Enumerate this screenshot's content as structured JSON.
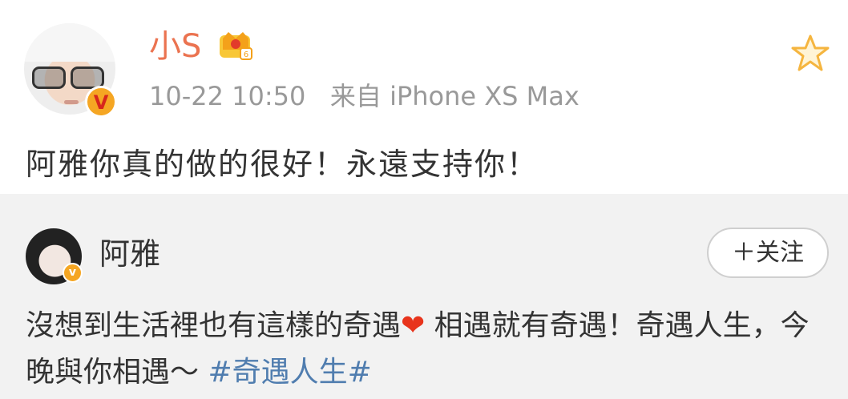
{
  "original_post": {
    "username": "小S",
    "meta_time": "10-22 10:50",
    "meta_source": "来自 iPhone XS Max",
    "text": "阿雅你真的做的很好！永遠支持你！"
  },
  "reposted": {
    "username": "阿雅",
    "follow_label": "＋关注",
    "text_part1": "沒想到生活裡也有這樣的奇遇",
    "heart_emoji": "❤",
    "text_part2": " 相遇就有奇遇！奇遇人生，今晚與你相遇～ ",
    "hashtag": "#奇遇人生#"
  },
  "icons": {
    "verified_badge": "verified-icon",
    "crown": "vip-crown-icon",
    "favorite": "star-icon"
  },
  "colors": {
    "username_orange": "#eb7350",
    "hashtag_blue": "#507daf",
    "meta_gray": "#999999",
    "repost_bg": "#f2f2f2",
    "heart_red": "#e8341c"
  }
}
